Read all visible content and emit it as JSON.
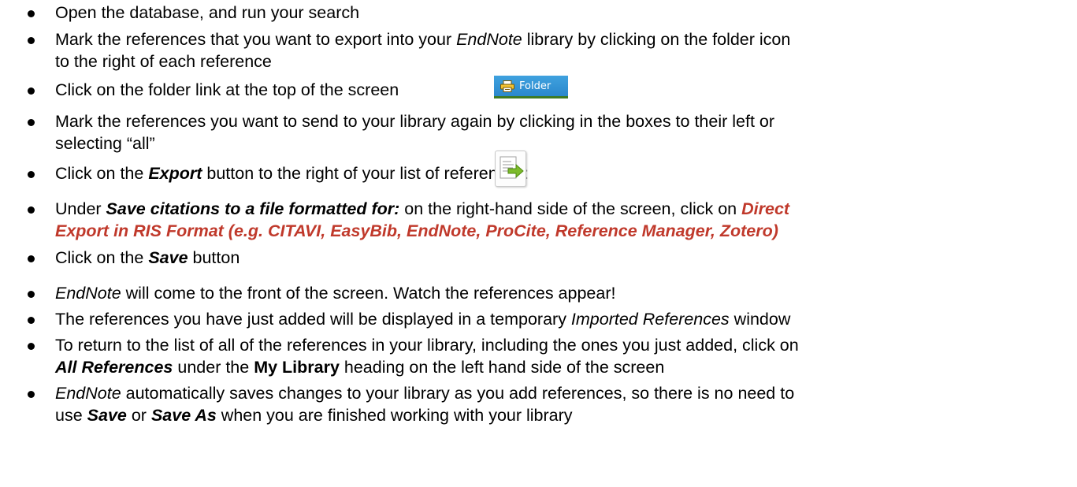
{
  "items": [
    {
      "parts": [
        {
          "t": "Open the database, and run your search"
        }
      ]
    },
    {
      "parts": [
        {
          "t": "Mark the references that you want to export into your "
        },
        {
          "t": "EndNote",
          "s": "i"
        },
        {
          "t": " library by clicking on the folder icon"
        }
      ]
    },
    {
      "parts": [
        {
          "t": "to the right of each reference"
        }
      ]
    },
    {
      "parts": [
        {
          "t": "Click on the folder link at the top of the screen"
        }
      ]
    },
    {
      "parts": [
        {
          "t": "Mark the references you want to send to your library again by clicking in the boxes to their left or"
        }
      ]
    },
    {
      "parts": [
        {
          "t": "selecting “all”"
        }
      ]
    },
    {
      "parts": [
        {
          "t": "Click on the "
        },
        {
          "t": "Export",
          "s": "bi"
        },
        {
          "t": " button to the right of your list of references:"
        }
      ]
    },
    {
      "parts": [
        {
          "t": "Under "
        },
        {
          "t": "Save citations to a file formatted for:",
          "s": "bi"
        },
        {
          "t": " on the right-hand side of the screen, click on "
        },
        {
          "t": "Direct",
          "s": "bi red"
        }
      ]
    },
    {
      "parts": [
        {
          "t": "Export in RIS Format (e.g. CITAVI, EasyBib, EndNote, ProCite, Reference Manager, Zotero)",
          "s": "bi red"
        }
      ]
    },
    {
      "parts": [
        {
          "t": "Click on the "
        },
        {
          "t": "Save",
          "s": "bi"
        },
        {
          "t": " button"
        }
      ]
    },
    {
      "parts": [
        {
          "t": "EndNote",
          "s": "i"
        },
        {
          "t": " will come to the front of the screen. Watch the references appear!"
        }
      ]
    },
    {
      "parts": [
        {
          "t": "The references you have just added will be displayed in a temporary "
        },
        {
          "t": "Imported References",
          "s": "i"
        },
        {
          "t": " window"
        }
      ]
    },
    {
      "parts": [
        {
          "t": "To return to the list of all of the references in your library, including the ones you just added, click on"
        }
      ]
    },
    {
      "parts": [
        {
          "t": "All References",
          "s": "bi"
        },
        {
          "t": " under the "
        },
        {
          "t": "My Library",
          "s": "b"
        },
        {
          "t": " heading on the left hand side of the screen"
        }
      ]
    },
    {
      "parts": [
        {
          "t": "EndNote",
          "s": "i"
        },
        {
          "t": " automatically saves changes to your library as you add references, so there is no need to"
        }
      ]
    },
    {
      "parts": [
        {
          "t": "use "
        },
        {
          "t": "Save",
          "s": "bi"
        },
        {
          "t": " or "
        },
        {
          "t": "Save As",
          "s": "bi"
        },
        {
          "t": " when you are finished working with your library"
        }
      ]
    }
  ],
  "folder_button": {
    "label": "Folder",
    "icon": "printer-icon"
  },
  "export_button": {
    "icon": "export-icon"
  }
}
